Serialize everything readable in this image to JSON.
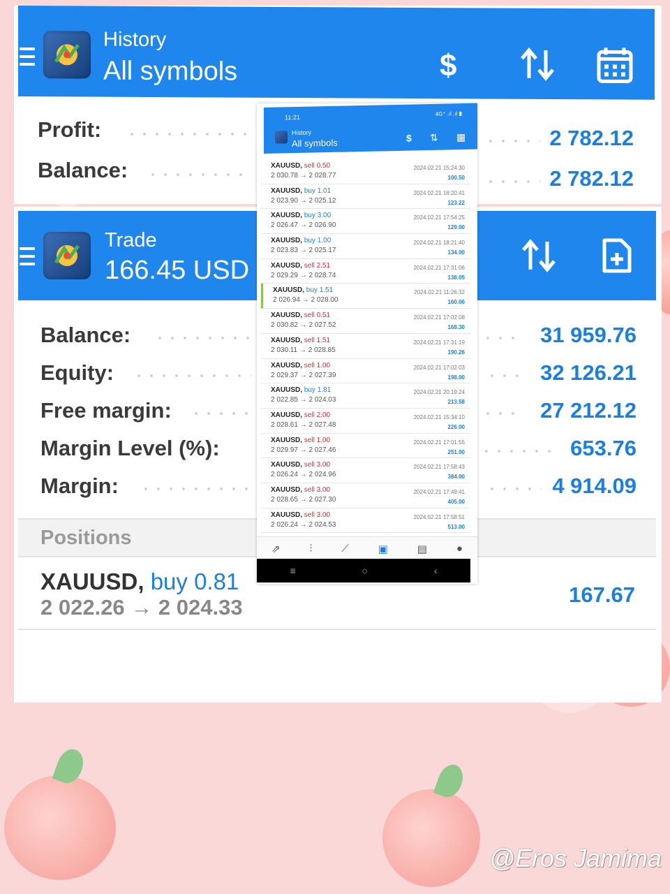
{
  "history": {
    "title": "History",
    "subtitle": "All symbols",
    "rows": [
      {
        "label": "Profit:",
        "value": "2 782.12"
      },
      {
        "label": "Balance:",
        "value": "2 782.12"
      }
    ]
  },
  "trade": {
    "title": "Trade",
    "subtitle": "166.45 USD",
    "rows": [
      {
        "label": "Balance:",
        "value": "31 959.76"
      },
      {
        "label": "Equity:",
        "value": "32 126.21"
      },
      {
        "label": "Free margin:",
        "value": "27 212.12"
      },
      {
        "label": "Margin Level (%):",
        "value": "653.76"
      },
      {
        "label": "Margin:",
        "value": "4 914.09"
      }
    ],
    "positions_label": "Positions",
    "position": {
      "symbol": "XAUUSD,",
      "direction": "buy 0.81",
      "prices": "2 022.26 → 2 024.33",
      "profit": "167.67"
    }
  },
  "phone": {
    "status_time": "11:21",
    "status_right": "4G⁺ .ıl .ıl ▮",
    "title": "History",
    "subtitle": "All symbols",
    "trades": [
      {
        "symbol": "XAUUSD,",
        "dir": "sell",
        "dir_label": "sell 0.50",
        "prices": "2 030.78 → 2 028.77",
        "time": "2024.02.21 15:24:30",
        "profit": "100.50"
      },
      {
        "symbol": "XAUUSD,",
        "dir": "buy",
        "dir_label": "buy 1.01",
        "prices": "2 023.90 → 2 025.12",
        "time": "2024.02.21 18:20:41",
        "profit": "123.22"
      },
      {
        "symbol": "XAUUSD,",
        "dir": "buy",
        "dir_label": "buy 3.00",
        "prices": "2 026.47 → 2 026.90",
        "time": "2024.02.21 17:54:25",
        "profit": "129.00"
      },
      {
        "symbol": "XAUUSD,",
        "dir": "buy",
        "dir_label": "buy 1.00",
        "prices": "2 023.83 → 2 025.17",
        "time": "2024.02.21 18:21:40",
        "profit": "134.00"
      },
      {
        "symbol": "XAUUSD,",
        "dir": "sell",
        "dir_label": "sell 2.51",
        "prices": "2 029.29 → 2 028.74",
        "time": "2024.02.21 17:31:06",
        "profit": "138.05"
      },
      {
        "symbol": "XAUUSD,",
        "dir": "buy",
        "dir_label": "buy 1.51",
        "prices": "2 026.94 → 2 028.00",
        "time": "2024.02.21 11:26:32",
        "profit": "160.06"
      },
      {
        "symbol": "XAUUSD,",
        "dir": "sell",
        "dir_label": "sell 0.51",
        "prices": "2 030.82 → 2 027.52",
        "time": "2024.02.21 17:02:08",
        "profit": "168.30"
      },
      {
        "symbol": "XAUUSD,",
        "dir": "sell",
        "dir_label": "sell 1.51",
        "prices": "2 030.11 → 2 028.85",
        "time": "2024.02.21 17:31:19",
        "profit": "190.26"
      },
      {
        "symbol": "XAUUSD,",
        "dir": "sell",
        "dir_label": "sell 1.00",
        "prices": "2 029.37 → 2 027.39",
        "time": "2024.02.21 17:02:03",
        "profit": "198.00"
      },
      {
        "symbol": "XAUUSD,",
        "dir": "buy",
        "dir_label": "buy 1.81",
        "prices": "2 022.85 → 2 024.03",
        "time": "2024.02.21 20:19:24",
        "profit": "213.58"
      },
      {
        "symbol": "XAUUSD,",
        "dir": "sell",
        "dir_label": "sell 2.00",
        "prices": "2 028.61 → 2 027.48",
        "time": "2024.02.21 15:34:10",
        "profit": "226.00"
      },
      {
        "symbol": "XAUUSD,",
        "dir": "sell",
        "dir_label": "sell 1.00",
        "prices": "2 029.97 → 2 027.46",
        "time": "2024.02.21 17:01:55",
        "profit": "251.00"
      },
      {
        "symbol": "XAUUSD,",
        "dir": "sell",
        "dir_label": "sell 3.00",
        "prices": "2 026.24 → 2 024.96",
        "time": "2024.02.21 17:58:43",
        "profit": "384.00"
      },
      {
        "symbol": "XAUUSD,",
        "dir": "sell",
        "dir_label": "sell 3.00",
        "prices": "2 028.65 → 2 027.30",
        "time": "2024.02.21 17:49:41",
        "profit": "405.00"
      },
      {
        "symbol": "XAUUSD,",
        "dir": "sell",
        "dir_label": "sell 3.00",
        "prices": "2 026.24 → 2 024.53",
        "time": "2024.02.21 17:58:51",
        "profit": "513.00"
      }
    ],
    "nav": [
      "quotes-icon",
      "chart-icon",
      "trade-icon",
      "history-icon",
      "news-icon",
      "messages-icon"
    ]
  },
  "watermark": "@Eros Jamima",
  "colors": {
    "accent_blue": "#1f86ee",
    "value_blue": "#1a7fe0",
    "sell_red": "#d32f2f",
    "background_pink": "#fbd8d8"
  }
}
